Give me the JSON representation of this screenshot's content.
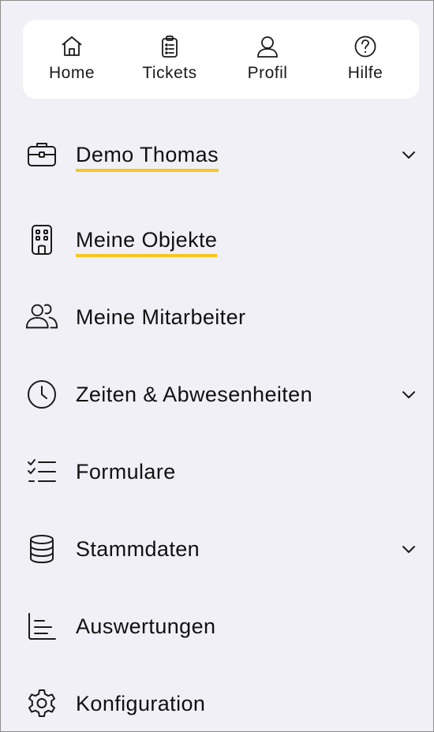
{
  "topnav": {
    "items": [
      {
        "label": "Home",
        "icon": "home-icon"
      },
      {
        "label": "Tickets",
        "icon": "clipboard-icon"
      },
      {
        "label": "Profil",
        "icon": "user-icon"
      },
      {
        "label": "Hilfe",
        "icon": "help-circle-icon"
      }
    ]
  },
  "menu": {
    "items": [
      {
        "label": "Demo Thomas",
        "icon": "briefcase-icon",
        "expandable": true,
        "active": true
      },
      {
        "label": "Meine Objekte",
        "icon": "building-icon",
        "expandable": false,
        "active": true
      },
      {
        "label": "Meine Mitarbeiter",
        "icon": "users-icon",
        "expandable": false,
        "active": false
      },
      {
        "label": "Zeiten & Abwesenheiten",
        "icon": "clock-icon",
        "expandable": true,
        "active": false
      },
      {
        "label": "Formulare",
        "icon": "checklist-icon",
        "expandable": false,
        "active": false
      },
      {
        "label": "Stammdaten",
        "icon": "database-icon",
        "expandable": true,
        "active": false
      },
      {
        "label": "Auswertungen",
        "icon": "bar-chart-icon",
        "expandable": false,
        "active": false
      },
      {
        "label": "Konfiguration",
        "icon": "gear-icon",
        "expandable": false,
        "active": false
      }
    ]
  },
  "colors": {
    "accent_underline": "#f6c624",
    "background": "#f1f0f6",
    "card": "#ffffff"
  }
}
